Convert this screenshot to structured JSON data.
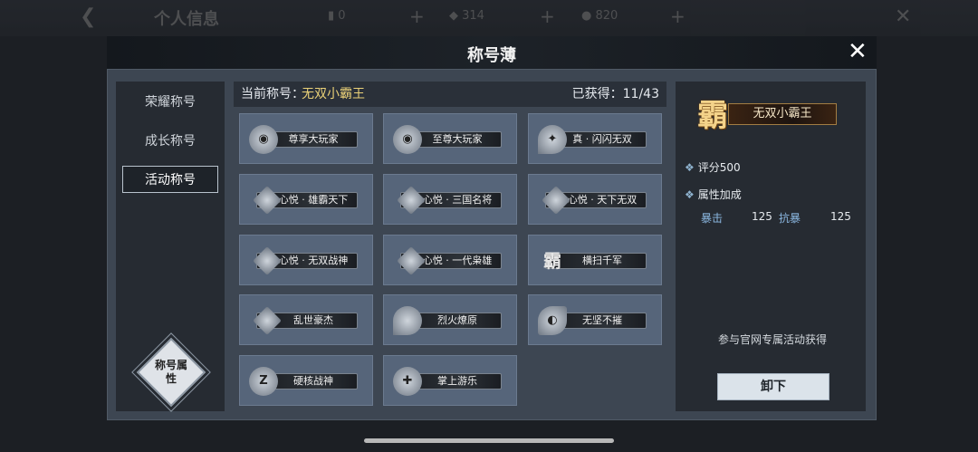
{
  "background": {
    "title": "个人信息",
    "res1": "0",
    "res2": "314",
    "res3": "820"
  },
  "modal": {
    "title": "称号薄"
  },
  "tabs": [
    {
      "label": "荣耀称号",
      "active": false
    },
    {
      "label": "成长称号",
      "active": false
    },
    {
      "label": "活动称号",
      "active": true
    }
  ],
  "attr_button": "称号属性",
  "current": {
    "label": "当前称号：",
    "value": "无双小霸王",
    "obtained": "已获得：11/43"
  },
  "titles": [
    {
      "name": "尊享大玩家",
      "icon": "wechat-icon"
    },
    {
      "name": "至尊大玩家",
      "icon": "wechat-icon"
    },
    {
      "name": "真 · 闪闪无双",
      "icon": "ghost-icon"
    },
    {
      "name": "心悦 · 雄霸天下",
      "icon": "wing-icon"
    },
    {
      "name": "心悦 · 三国名将",
      "icon": "wing-icon"
    },
    {
      "name": "心悦 · 天下无双",
      "icon": "wing-icon"
    },
    {
      "name": "心悦 · 无双战神",
      "icon": "wing-icon"
    },
    {
      "name": "心悦 · 一代枭雄",
      "icon": "wing-icon"
    },
    {
      "name": "横扫千军",
      "icon": "ba-char-icon"
    },
    {
      "name": "乱世豪杰",
      "icon": "blade-icon"
    },
    {
      "name": "烈火燎原",
      "icon": "flame-icon"
    },
    {
      "name": "无坚不摧",
      "icon": "eye-icon"
    },
    {
      "name": "硬核战神",
      "icon": "z-emblem-icon"
    },
    {
      "name": "掌上游乐",
      "icon": "gamepad-icon"
    }
  ],
  "detail": {
    "badge_char": "霸",
    "badge_name": "无双小霸王",
    "score_label": "评分500",
    "attr_label": "属性加成",
    "stats": [
      {
        "key": "暴击",
        "value": "125"
      },
      {
        "key": "抗暴",
        "value": "125"
      }
    ],
    "source": "参与官网专属活动获得",
    "unload_label": "卸下"
  }
}
